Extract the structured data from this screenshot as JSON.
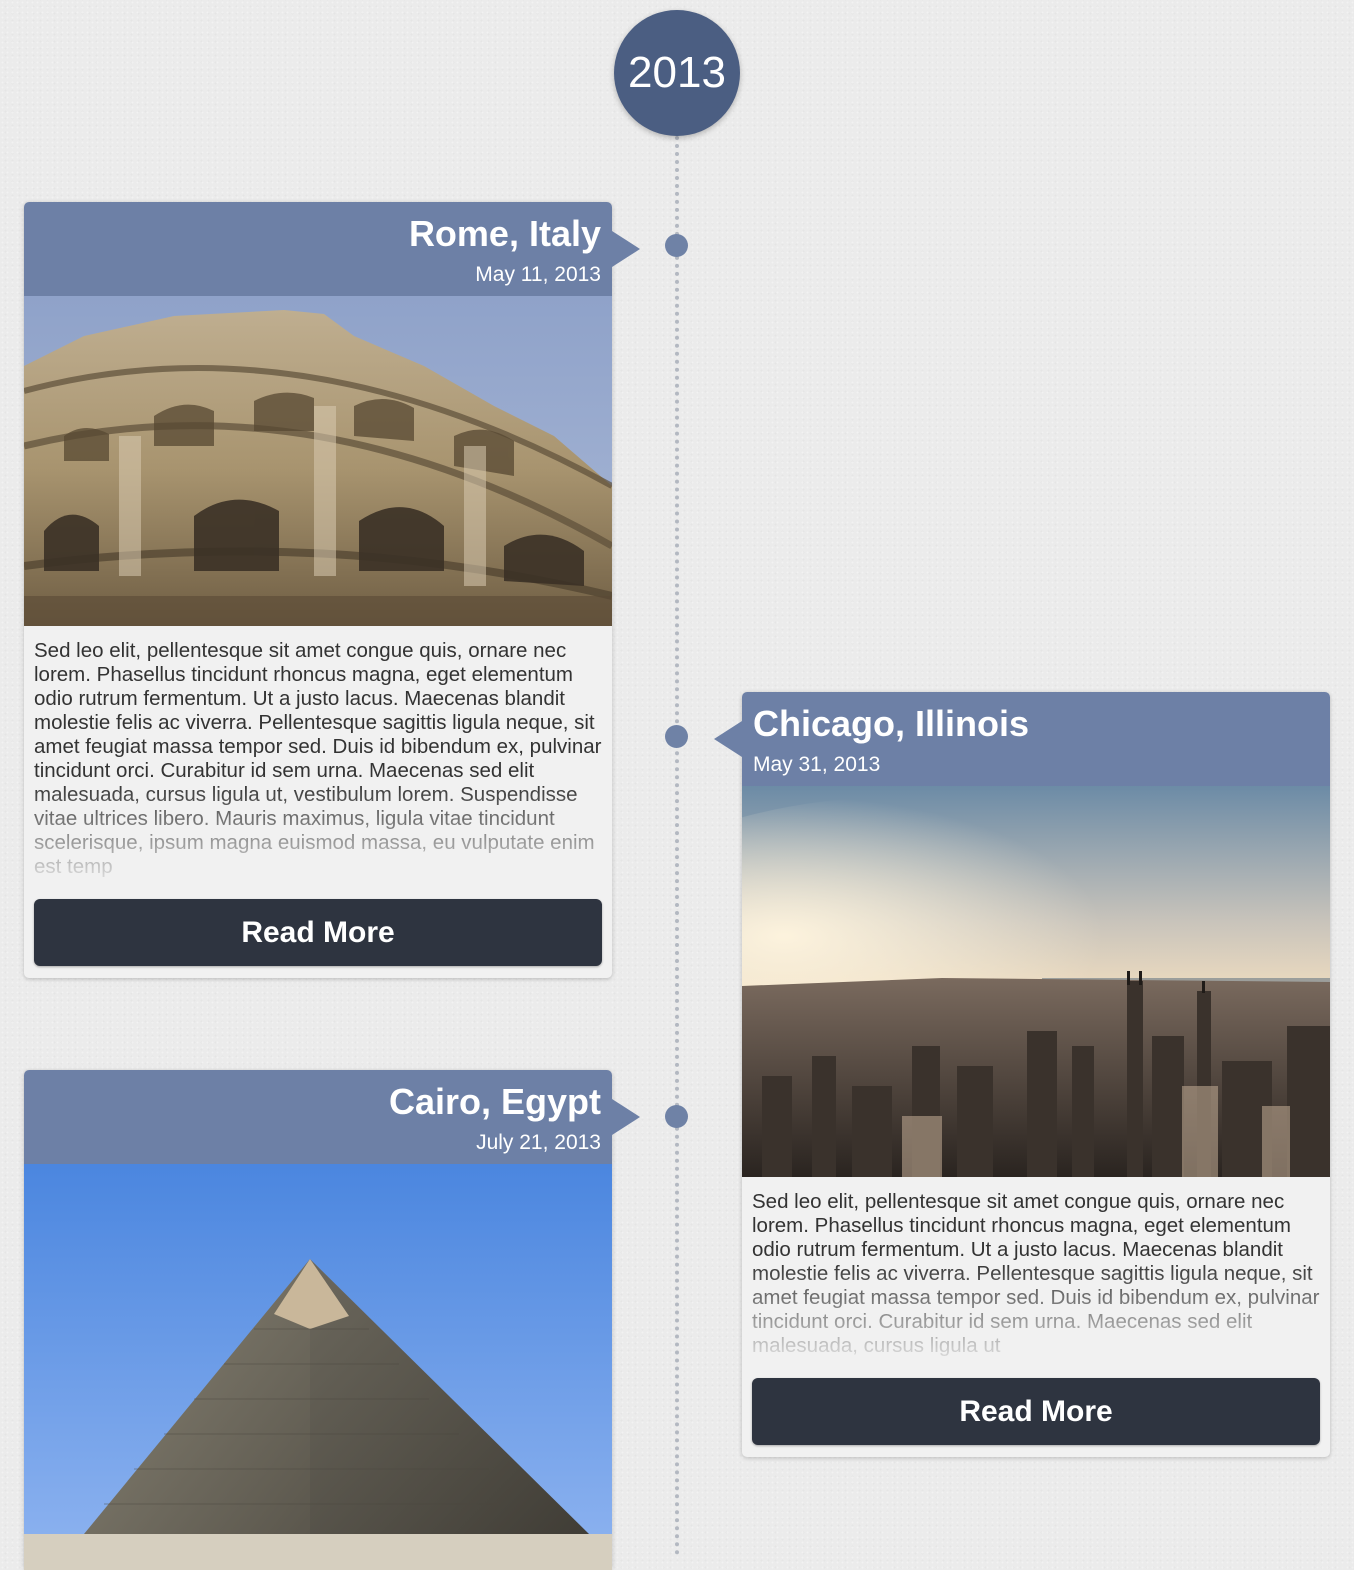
{
  "timeline": {
    "year": "2013",
    "entries": [
      {
        "title": "Rome, Italy",
        "date": "May 11, 2013",
        "image": "colosseum-photo",
        "text": "Sed leo elit, pellentesque sit amet congue quis, ornare nec lorem. Phasellus tincidunt rhoncus magna, eget elementum odio rutrum fermentum. Ut a justo lacus. Maecenas blandit molestie felis ac viverra. Pellentesque sagittis ligula neque, sit amet feugiat massa tempor sed. Duis id bibendum ex, pulvinar tincidunt orci. Curabitur id sem urna. Maecenas sed elit malesuada, cursus ligula ut, vestibulum lorem. Suspendisse vitae ultrices libero. Mauris maximus, ligula vitae tincidunt scelerisque, ipsum magna euismod massa, eu vulputate enim est temp",
        "button": "Read More"
      },
      {
        "title": "Chicago, Illinois",
        "date": "May 31, 2013",
        "image": "chicago-skyline-photo",
        "text": "Sed leo elit, pellentesque sit amet congue quis, ornare nec lorem. Phasellus tincidunt rhoncus magna, eget elementum odio rutrum fermentum. Ut a justo lacus. Maecenas blandit molestie felis ac viverra. Pellentesque sagittis ligula neque, sit amet feugiat massa tempor sed. Duis id bibendum ex, pulvinar tincidunt orci. Curabitur id sem urna. Maecenas sed elit malesuada, cursus ligula ut",
        "button": "Read More"
      },
      {
        "title": "Cairo, Egypt",
        "date": "July 21, 2013",
        "image": "pyramid-photo"
      }
    ]
  },
  "colors": {
    "badge": "#4b5e82",
    "card_header": "#6d80a6",
    "node_dot": "#6f82a6",
    "button": "#2e3440",
    "card_body": "#f1f1f1",
    "page_background": "#ebebeb"
  }
}
